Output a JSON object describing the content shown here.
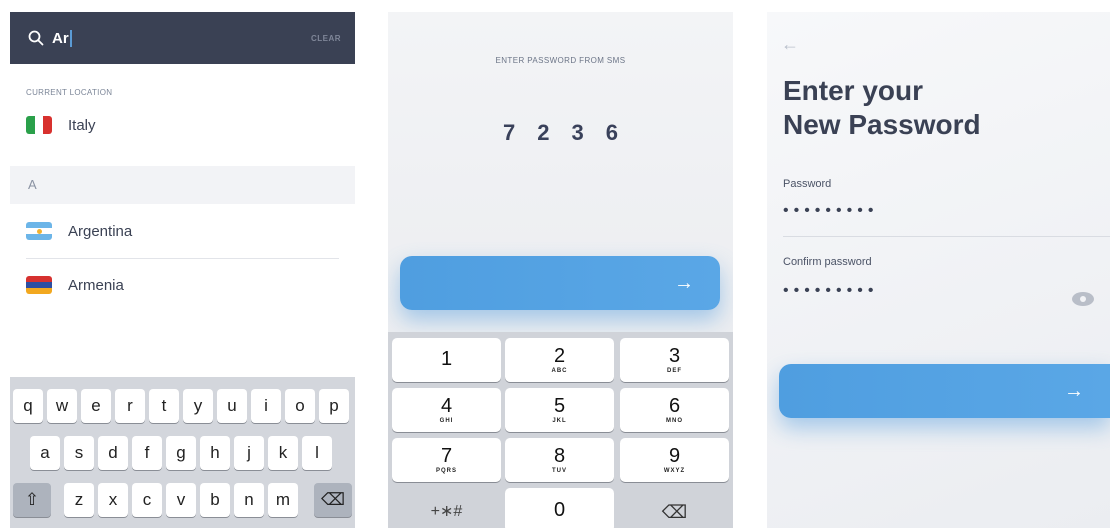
{
  "search_screen": {
    "query": "Ar",
    "clear_label": "CLEAR",
    "current_location_label": "CURRENT LOCATION",
    "current_location": "Italy",
    "section_letter": "A",
    "countries": [
      "Argentina",
      "Armenia"
    ],
    "keyboard": {
      "row1": [
        "q",
        "w",
        "e",
        "r",
        "t",
        "y",
        "u",
        "i",
        "o",
        "p"
      ],
      "row2": [
        "a",
        "s",
        "d",
        "f",
        "g",
        "h",
        "j",
        "k",
        "l"
      ],
      "row3": [
        "z",
        "x",
        "c",
        "v",
        "b",
        "n",
        "m"
      ],
      "shift": "⇧",
      "backspace": "⌫"
    }
  },
  "sms_screen": {
    "title": "ENTER PASSWORD FROM SMS",
    "code": [
      "7",
      "2",
      "3",
      "6"
    ],
    "submit_arrow": "→",
    "numpad": [
      {
        "n": "1",
        "l": ""
      },
      {
        "n": "2",
        "l": "ABC"
      },
      {
        "n": "3",
        "l": "DEF"
      },
      {
        "n": "4",
        "l": "GHI"
      },
      {
        "n": "5",
        "l": "JKL"
      },
      {
        "n": "6",
        "l": "MNO"
      },
      {
        "n": "7",
        "l": "PQRS"
      },
      {
        "n": "8",
        "l": "TUV"
      },
      {
        "n": "9",
        "l": "WXYZ"
      },
      {
        "n": "+∗#",
        "l": ""
      },
      {
        "n": "0",
        "l": ""
      },
      {
        "n": "⌫",
        "l": ""
      }
    ]
  },
  "password_screen": {
    "back_icon": "←",
    "title_line1": "Enter your",
    "title_line2": "New Password",
    "password_label": "Password",
    "password_value": "•••••••••",
    "confirm_label": "Confirm password",
    "confirm_value": "•••••••••",
    "submit_arrow": "→"
  },
  "colors": {
    "header_dark": "#3a4154",
    "accent_blue": "#4f9ee0",
    "keyboard_bg": "#d3d6dc"
  }
}
